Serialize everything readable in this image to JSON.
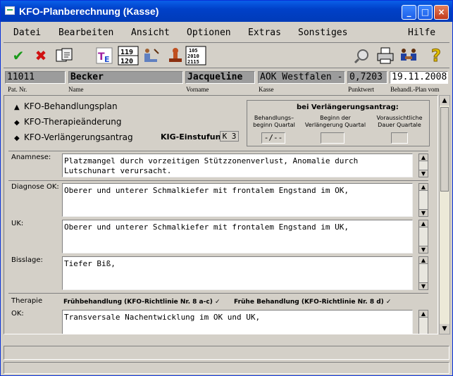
{
  "window": {
    "title": "KFO-Planberechnung (Kasse)",
    "min": "_",
    "max": "□",
    "close": "×"
  },
  "menu": [
    "Datei",
    "Bearbeiten",
    "Ansicht",
    "Optionen",
    "Extras",
    "Sonstiges",
    "Hilfe"
  ],
  "toolbar": {
    "icons": [
      "check",
      "cross",
      "document-edit",
      "tex-document",
      "calendar-119-120",
      "dentist-chair",
      "stamp",
      "number-list",
      "magnifier",
      "printer",
      "people",
      "help"
    ],
    "num1": "119",
    "num2": "120",
    "list": "105 2010 2115",
    "help": "?"
  },
  "patient": {
    "nr": "11011",
    "name": "Becker",
    "vorname": "Jacqueline",
    "kasse": "AOK Westfalen -",
    "punktwert": "0,7203",
    "datum": "19.11.2008",
    "captions": {
      "nr": "Pat. Nr.",
      "name": "Name",
      "vorname": "Vorname",
      "kasse": "Kasse",
      "punktwert": "Punktwert",
      "datum": "Behandl.-Plan vom"
    }
  },
  "options": [
    {
      "label": "KFO-Behandlungsplan",
      "mark": "▲"
    },
    {
      "label": "KFO-Therapieänderung",
      "mark": "◆"
    },
    {
      "label": "KFO-Verlängerungsantrag",
      "mark": "◆"
    }
  ],
  "kig": {
    "label": "KIG-Einstufung",
    "value": "K 3"
  },
  "extension": {
    "title": "bei Verlängerungsantrag:",
    "col1": "Behandlungs–\nbeginn Quartal",
    "col2": "Beginn der\nVerlängerung Quartal",
    "col3": "Voraussichtliche\nDauer Quartale",
    "val1": "-/--",
    "val2": "",
    "val3": ""
  },
  "sections": {
    "anamnese": {
      "label": "Anamnese:",
      "text": "Platzmangel durch vorzeitigen Stützzonenverlust, Anomalie durch Lutschunart verursacht."
    },
    "diagnose_ok": {
      "label": "Diagnose OK:",
      "text": "Oberer und unterer Schmalkiefer mit frontalem Engstand im OK,"
    },
    "uk": {
      "label": "UK:",
      "text": "Oberer und unterer Schmalkiefer mit frontalem Engstand im UK,"
    },
    "bisslage": {
      "label": "Bisslage:",
      "text": "Tiefer Biß,"
    },
    "therapie": {
      "label": "Therapie",
      "ok_label": "OK:",
      "text": "Transversale Nachentwicklung im OK und UK,"
    }
  },
  "therapy_options": [
    {
      "label": "Frühbehandlung (KFO-Richtlinie Nr. 8 a-c)",
      "mark": "✓"
    },
    {
      "label": "Frühe Behandlung (KFO-Richtlinie Nr. 8 d)",
      "mark": "✓"
    }
  ],
  "scroll": {
    "up": "▲",
    "down": "▼"
  }
}
